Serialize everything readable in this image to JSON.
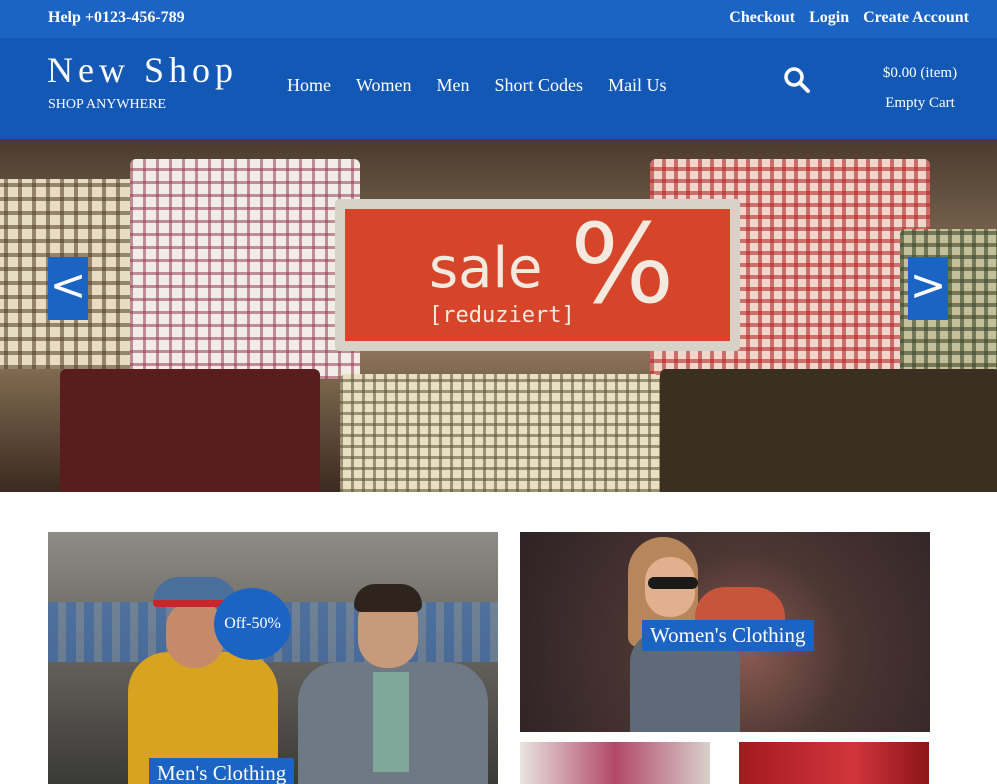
{
  "topbar": {
    "help": "Help +0123-456-789",
    "links": [
      "Checkout",
      "Login",
      "Create Account"
    ]
  },
  "header": {
    "logo": "New Shop",
    "tagline": "SHOP ANYWHERE",
    "nav": [
      "Home",
      "Women",
      "Men",
      "Short Codes",
      "Mail Us"
    ],
    "search_icon": "search-icon",
    "cart": {
      "total": "$0.00 (item)",
      "status": "Empty Cart"
    }
  },
  "hero": {
    "sign_word": "sale",
    "sign_symbol": "%",
    "sign_sub": "[reduziert]",
    "prev": "<",
    "next": ">"
  },
  "tiles": {
    "men": {
      "label": "Men's Clothing",
      "badge": "Off-50%"
    },
    "women": {
      "label": "Women's Clothing"
    }
  },
  "colors": {
    "topbar": "#1c64c3",
    "header": "#1358b5",
    "accent": "#1c64c3"
  }
}
